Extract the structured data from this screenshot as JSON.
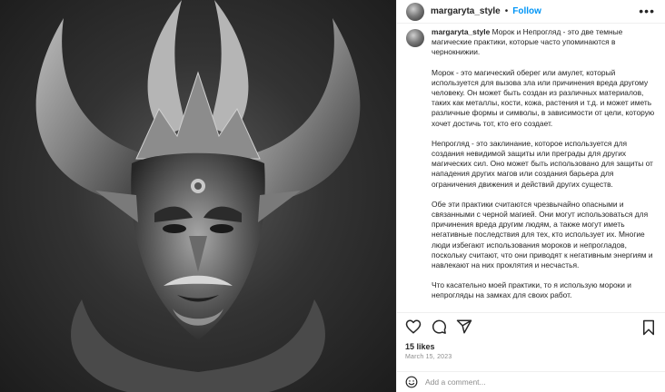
{
  "post": {
    "username": "margaryta_style",
    "separator": "•",
    "follow_label": "Follow",
    "more_label": "•••"
  },
  "caption": {
    "username": "margaryta_style",
    "paragraphs": [
      "Морок и Непрогляд - это две темные магические практики, которые часто упоминаются в чернокнижии.",
      "Морок - это магический оберег или амулет, который используется для вызова зла или причинения вреда другому человеку. Он может быть создан из различных материалов, таких как металлы, кости, кожа, растения и т.д. и может иметь различные формы и символы, в зависимости от цели, которую хочет достичь тот, кто его создает.",
      "Непрогляд - это заклинание, которое используется для создания невидимой защиты или преграды для других магических сил. Оно может быть использовано для защиты от нападения других магов или создания барьера для ограничения движения и действий других существ.",
      "Обе эти практики считаются чрезвычайно опасными и связанными с черной магией. Они могут использоваться для причинения вреда другим людям, а также могут иметь негативные последствия для тех, кто использует их. Многие люди избегают использования мороков и непрогладов, поскольку считают, что они приводят к негативным энергиям и навлекают на них проклятия и несчастья.",
      "Что касательно моей практики, то я использую мороки и непрогляды на замках для своих работ."
    ]
  },
  "stats": {
    "likes": "15 likes",
    "date": "March 15, 2023"
  },
  "comment": {
    "placeholder": "Add a comment..."
  },
  "icons": {
    "like": "heart-icon",
    "comment": "comment-icon",
    "share": "share-icon",
    "save": "bookmark-icon",
    "emoji": "smiley-icon"
  },
  "colors": {
    "accent": "#0095f6",
    "text": "#262626",
    "muted": "#8e8e8e"
  }
}
